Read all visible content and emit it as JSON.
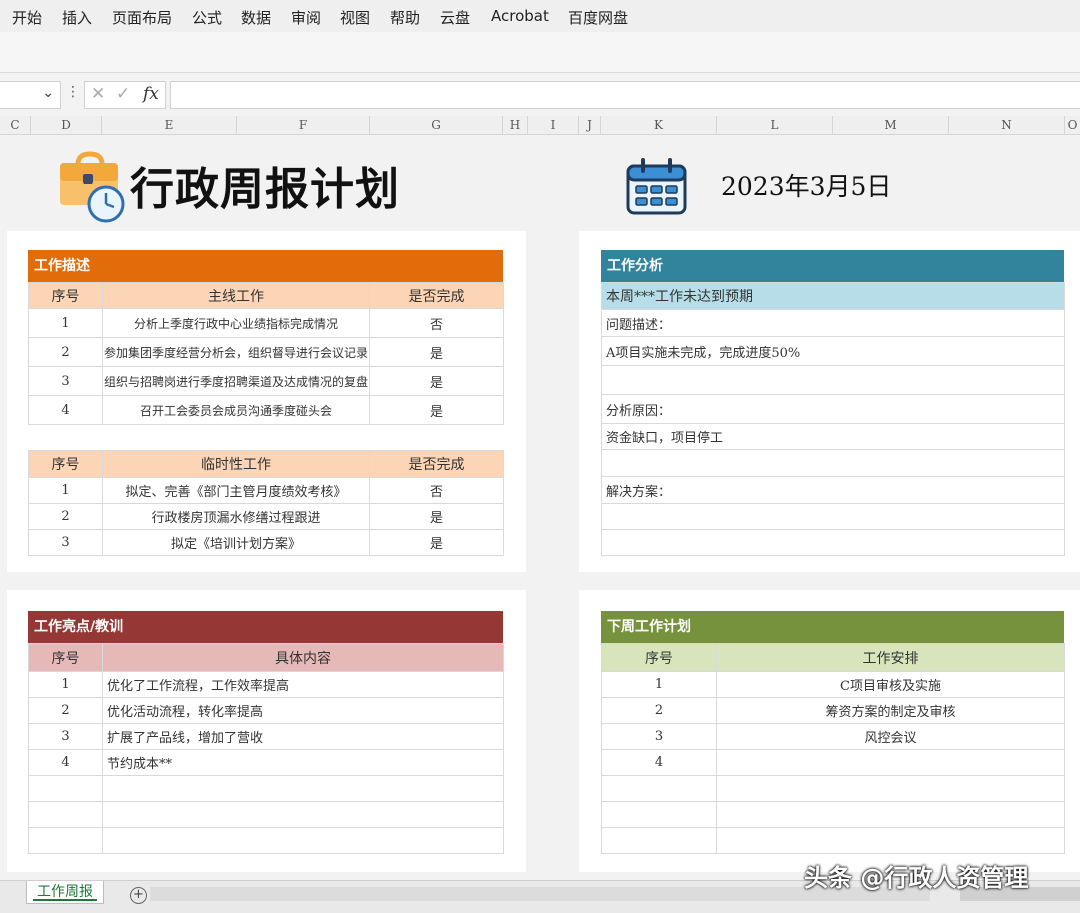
{
  "menu": [
    "开始",
    "插入",
    "页面布局",
    "公式",
    "数据",
    "审阅",
    "视图",
    "帮助",
    "云盘",
    "Acrobat",
    "百度网盘"
  ],
  "formula_bar": {
    "cancel": "✕",
    "confirm": "✓",
    "fx": "fx",
    "value": ""
  },
  "columns": [
    "C",
    "D",
    "E",
    "F",
    "G",
    "H",
    "I",
    "J",
    "K",
    "L",
    "M",
    "N",
    "O"
  ],
  "title": "行政周报计划",
  "date": "2023年3月5日",
  "work_desc": {
    "header": "工作描述",
    "main_table": {
      "cols": [
        "序号",
        "主线工作",
        "是否完成"
      ],
      "rows": [
        [
          "1",
          "分析上季度行政中心业绩指标完成情况",
          "否"
        ],
        [
          "2",
          "参加集团季度经营分析会，组织督导进行会议记录",
          "是"
        ],
        [
          "3",
          "组织与招聘岗进行季度招聘渠道及达成情况的复盘",
          "是"
        ],
        [
          "4",
          "召开工会委员会成员沟通季度碰头会",
          "是"
        ]
      ]
    },
    "temp_table": {
      "cols": [
        "序号",
        "临时性工作",
        "是否完成"
      ],
      "rows": [
        [
          "1",
          "拟定、完善《部门主管月度绩效考核》",
          "否"
        ],
        [
          "2",
          "行政楼房顶漏水修缮过程跟进",
          "是"
        ],
        [
          "3",
          "拟定《培训计划方案》",
          "是"
        ]
      ]
    }
  },
  "analysis": {
    "header": "工作分析",
    "rows": [
      "本周***工作未达到预期",
      "问题描述：",
      "A项目实施未完成，完成进度50%",
      "",
      "分析原因：",
      "资金缺口，项目停工",
      "",
      "解决方案：",
      "",
      ""
    ]
  },
  "highlights": {
    "header": "工作亮点/教训",
    "cols": [
      "序号",
      "具体内容"
    ],
    "rows": [
      [
        "1",
        "优化了工作流程，工作效率提高"
      ],
      [
        "2",
        "优化活动流程，转化率提高"
      ],
      [
        "3",
        "扩展了产品线，增加了营收"
      ],
      [
        "4",
        "节约成本**"
      ],
      [
        "",
        ""
      ],
      [
        "",
        ""
      ],
      [
        "",
        ""
      ]
    ]
  },
  "next_week": {
    "header": "下周工作计划",
    "cols": [
      "序号",
      "工作安排"
    ],
    "rows": [
      [
        "1",
        "C项目审核及实施"
      ],
      [
        "2",
        "筹资方案的制定及审核"
      ],
      [
        "3",
        "风控会议"
      ],
      [
        "4",
        ""
      ],
      [
        "",
        ""
      ],
      [
        "",
        ""
      ],
      [
        "",
        ""
      ]
    ]
  },
  "sheet_tab": "工作周报",
  "watermark": "头条 @行政人资管理",
  "colors": {
    "orange": "#e36c0a",
    "orange_light": "#fbd5b5",
    "teal": "#31849b",
    "teal_light": "#b7dee8",
    "red": "#953734",
    "red_light": "#e6b9b8",
    "green": "#76923c",
    "green_light": "#d7e4bc"
  }
}
